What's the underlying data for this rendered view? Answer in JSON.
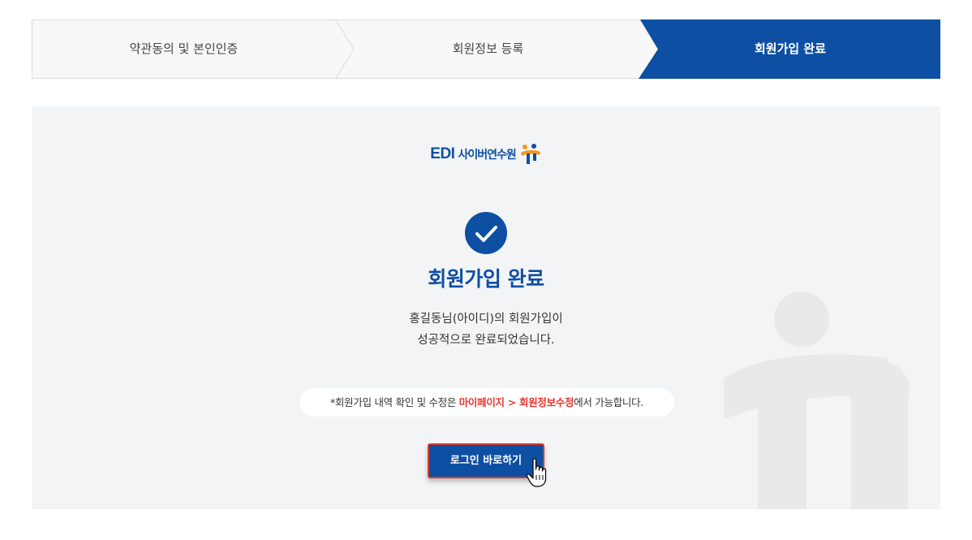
{
  "steps": [
    {
      "label": "약관동의 및 본인인증",
      "state": "done"
    },
    {
      "label": "회원정보 등록",
      "state": "done"
    },
    {
      "label": "회원가입 완료",
      "state": "current"
    }
  ],
  "logo": {
    "brand": "EDI",
    "name": "사이버연수원"
  },
  "complete": {
    "title": "회원가입 완료",
    "message_line1": "홍길동님(아이디)의 회원가입이",
    "message_line2": "성공적으로 완료되었습니다."
  },
  "note": {
    "prefix": "*회원가입 내역 확인 및 수정은 ",
    "highlight": "마이페이지 > 회원정보수정",
    "suffix": "에서 가능합니다."
  },
  "login_button": {
    "label": "로그인 바로하기"
  },
  "colors": {
    "primary": "#0d4fa3",
    "highlight": "#e8352d",
    "panel_bg": "#f3f4f6",
    "logo_orange": "#f39a1e"
  }
}
